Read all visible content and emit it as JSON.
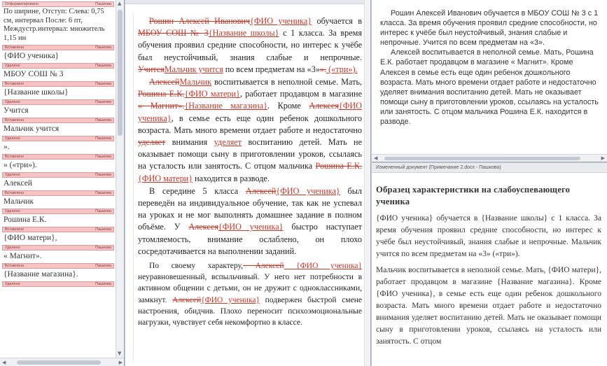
{
  "revisions": [
    {
      "type": "Отформатировано",
      "author": "Пашкова",
      "text": "По ширине, Отступ: Слева: 0,75 см, интервал После: 6 пт, Междустр.интервал: множитель 1,15 ин",
      "kind": "fmt"
    },
    {
      "type": "Вставлено",
      "author": "Пашкова",
      "text": "{ФИО ученика}",
      "kind": "ins"
    },
    {
      "type": "Удалено",
      "author": "Пашкова",
      "text": "МБОУ СОШ № 3",
      "kind": "del"
    },
    {
      "type": "Вставлено",
      "author": "Пашкова",
      "text": "{Название школы}",
      "kind": "ins"
    },
    {
      "type": "Удалено",
      "author": "Пашкова",
      "text": "Учится",
      "kind": "del"
    },
    {
      "type": "Вставлено",
      "author": "Пашкова",
      "text": "Мальчик учится",
      "kind": "ins"
    },
    {
      "type": "Удалено",
      "author": "Пашкова",
      "text": "».",
      "kind": "del"
    },
    {
      "type": "Вставлено",
      "author": "Пашкова",
      "text": "» («три»).",
      "kind": "ins"
    },
    {
      "type": "Удалено",
      "author": "Пашкова",
      "text": "Алексей",
      "kind": "del"
    },
    {
      "type": "Вставлено",
      "author": "Пашкова",
      "text": "Мальчик",
      "kind": "ins"
    },
    {
      "type": "Удалено",
      "author": "Пашкова",
      "text": "Рошина Е.К.",
      "kind": "del"
    },
    {
      "type": "Вставлено",
      "author": "Пашкова",
      "text": "{ФИО матери},",
      "kind": "ins"
    },
    {
      "type": "Удалено",
      "author": "Пашкова",
      "text": "« Магнит».",
      "kind": "del"
    },
    {
      "type": "Вставлено",
      "author": "Пашкова",
      "text": "{Название магазина}.",
      "kind": "ins"
    },
    {
      "type": "Удалено",
      "author": "Пашкова",
      "text": "",
      "kind": "del"
    }
  ],
  "document": {
    "p1": [
      {
        "t": "Рошин Алексей Иванович",
        "s": "del"
      },
      {
        "t": "{ФИО ученика}",
        "s": "ins"
      },
      {
        "t": " обучается в ",
        "s": ""
      },
      {
        "t": "МБОУ СОШ № 3",
        "s": "del"
      },
      {
        "t": "{Название школы}",
        "s": "ins"
      },
      {
        "t": " с 1 класса. За время обучения проявил средние способности, но интерес к учёбе был неустойчивый, знания слабые и непрочные. ",
        "s": ""
      },
      {
        "t": "Учится",
        "s": "del"
      },
      {
        "t": "Мальчик учится",
        "s": "ins"
      },
      {
        "t": " по всем предметам на «3»",
        "s": ""
      },
      {
        "t": "».",
        "s": "del"
      },
      {
        "t": " («три»).",
        "s": "ins"
      }
    ],
    "p2": [
      {
        "t": "Алексей",
        "s": "del"
      },
      {
        "t": "Мальчик",
        "s": "ins"
      },
      {
        "t": " воспитывается в неполной семье. Мать, ",
        "s": ""
      },
      {
        "t": "Рошина Е.К.",
        "s": "del"
      },
      {
        "t": "{ФИО матери}",
        "s": "ins"
      },
      {
        "t": ", работает продавцом в магазине ",
        "s": ""
      },
      {
        "t": "« Магнит».",
        "s": "del"
      },
      {
        "t": "{Название магазина}",
        "s": "ins"
      },
      {
        "t": ". Кроме ",
        "s": ""
      },
      {
        "t": "Алексея",
        "s": "del"
      },
      {
        "t": "{ФИО ученика}",
        "s": "ins"
      },
      {
        "t": ", в семье есть еще один ребенок дошкольного возраста. Мать много времени отдает работе и недостаточно ",
        "s": ""
      },
      {
        "t": "уделяет",
        "s": "del"
      },
      {
        "t": " внимания ",
        "s": ""
      },
      {
        "t": "уделяет",
        "s": "ins"
      },
      {
        "t": " воспитанию детей. Мать не оказывает помощи сыну в приготовлении уроков, ссылаясь на усталость или занятость. С отцом мальчика ",
        "s": ""
      },
      {
        "t": "Рошина Е.К.",
        "s": "del"
      },
      {
        "t": "{ФИО матери}",
        "s": "ins"
      },
      {
        "t": " находится в разводе.",
        "s": ""
      }
    ],
    "p3": [
      {
        "t": "В середине 5 класса ",
        "s": ""
      },
      {
        "t": "Алексей",
        "s": "del"
      },
      {
        "t": "{ФИО ученика}",
        "s": "ins"
      },
      {
        "t": " был переведён на индивидуальное обучение, так как не успевал на уроках и не мог выполнять домашнее задание в полном объёме. У ",
        "s": ""
      },
      {
        "t": "Алексея",
        "s": "del"
      },
      {
        "t": "{ФИО ученика}",
        "s": "ins"
      },
      {
        "t": " быстро наступает утомляемость, внимание ослаблено, он плохо сосредотачивается на выполнении заданий.",
        "s": ""
      }
    ],
    "p4": [
      {
        "t": "По своему характеру,",
        "s": ""
      },
      {
        "t": " Алексей",
        "s": "del"
      },
      {
        "t": " {ФИО ученика}",
        "s": "ins"
      },
      {
        "t": " неуравновешенный, вспыльчивый. У него нет потребности в активном общении с детьми, он не дружит с одноклассниками, замкнут. ",
        "s": ""
      },
      {
        "t": "Алексей",
        "s": "del"
      },
      {
        "t": "{ФИО ученика}",
        "s": "ins"
      },
      {
        "t": " подвержен быстрой смене настроения, обидчив. Плохо переносит психоэмоциональные нагрузки, чувствует себя некомфортно в классе.",
        "s": ""
      }
    ]
  },
  "final_view": {
    "p1": "Рошин Алексей Иванович обучается в МБОУ СОШ № 3 с 1 класса. За время обучения проявил средние способности, но интерес к учёбе был неустойчивый, знания слабые и непрочные. Учится по всем предметам на «3».",
    "p2": "Алексей воспитывается в неполной семье. Мать, Рошина Е.К. работает продавцом в магазине « Магнит». Кроме Алексея в семье есть еще один ребенок дошкольного возраста. Мать много времени отдает работе и недостаточно уделяет внимания воспитанию детей. Мать не оказывает помощи сыну в приготовлении уроков, ссылаясь на усталость или занятость. С отцом мальчика Рошина Е.К. находится в разводе."
  },
  "original_doc": {
    "window_title": "Измененный документ (Примечание 2.docx - Пашкова)",
    "heading": "Образец характеристики на слабоуспевающего ученика",
    "p1": "{ФИО ученика} обучается в {Название школы} с 1 класса. За время обучения проявил средние способности, но интерес к учёбе был неустойчивый, знания слабые и непрочные. Мальчик учится по всем предметам на «3» («три»).",
    "p2": "Мальчик воспитывается в неполной семье. Мать, {ФИО матери}, работает продавцом в магазине {Название магазина}. Кроме {ФИО ученика}, в семье есть еще один ребенок дошкольного возраста. Мать много времени отдает работе и недостаточно внимания уделяет воспитанию детей. Мать не оказывает помощи сыну в приготовлении уроков, ссылаясь на усталость или занятость. С отцом"
  },
  "colors": {
    "change": "#c0392b",
    "revision_header": "#f4c4c4"
  }
}
